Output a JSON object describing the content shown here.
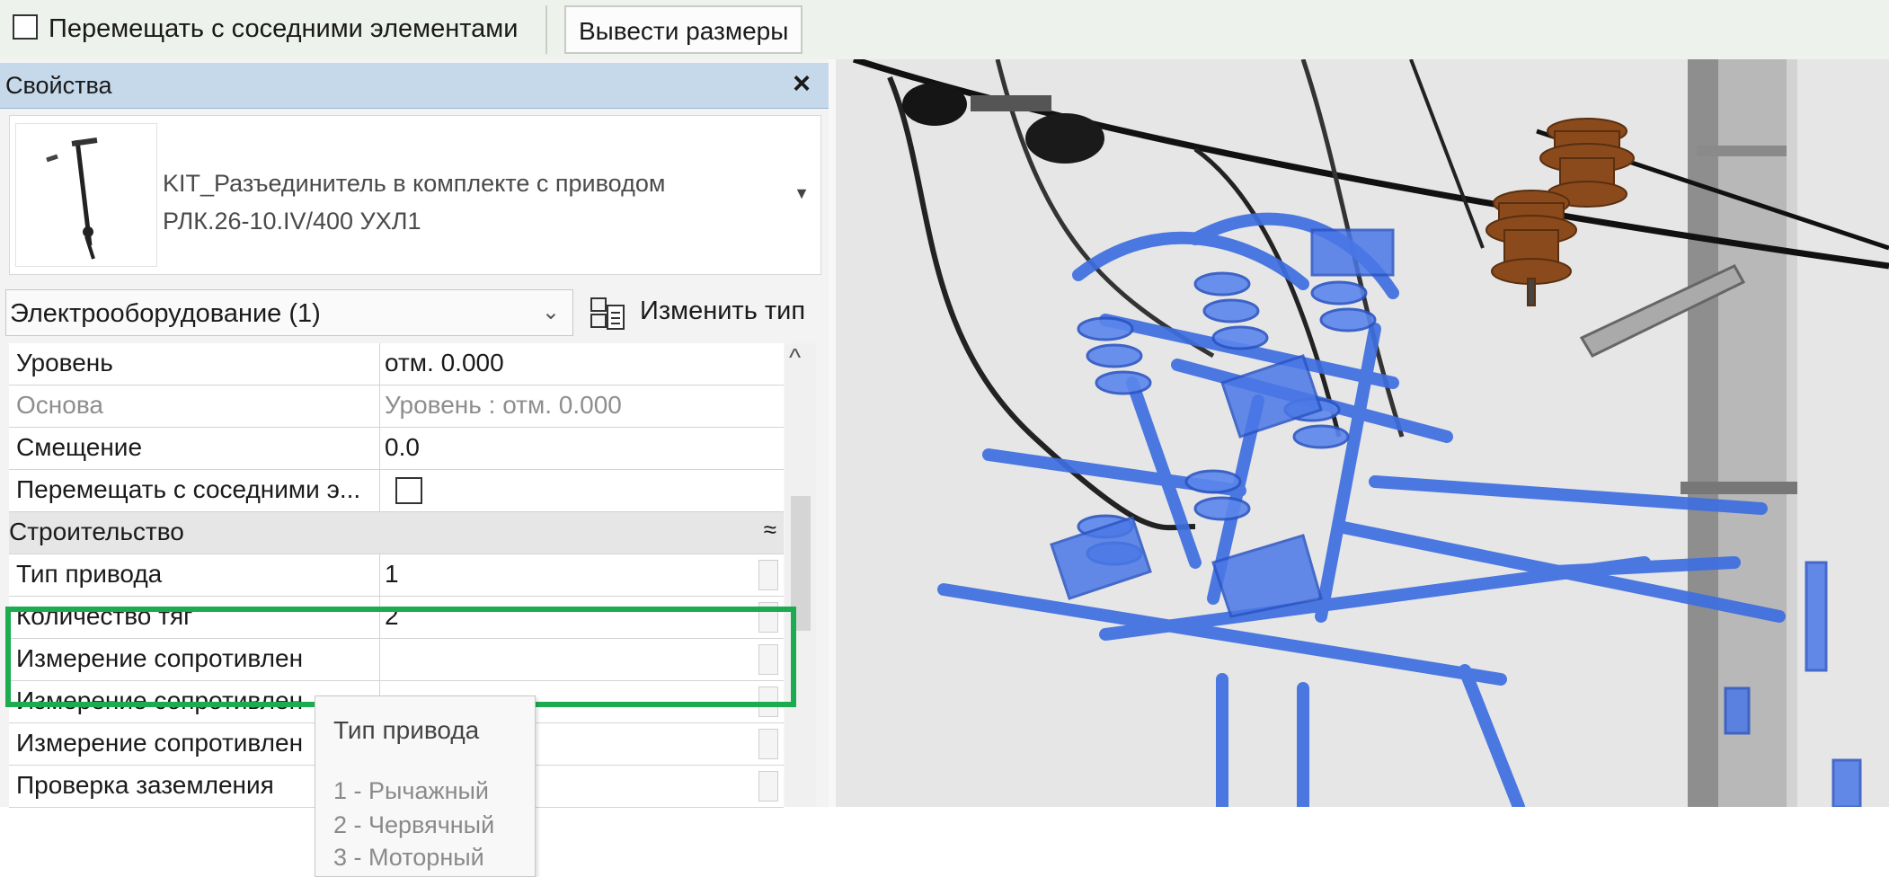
{
  "toolbar": {
    "move_with_neighbors_label": "Перемещать с соседними элементами",
    "show_dimensions_label": "Вывести размеры"
  },
  "properties": {
    "title": "Свойства",
    "close_glyph": "×",
    "type_name_line1": "KIT_Разъединитель в комплекте с приводом",
    "type_name_line2": "РЛК.26-10.IV/400 УХЛ1",
    "category": "Электрооборудование (1)",
    "edit_type_label": "Изменить тип",
    "rows": [
      {
        "name": "Уровень",
        "value": "отм. 0.000"
      },
      {
        "name": "Основа",
        "value": "Уровень : отм. 0.000"
      },
      {
        "name": "Смещение",
        "value": "0.0"
      },
      {
        "name": "Перемещать с соседними э...",
        "value": ""
      }
    ],
    "group_name": "Строительство",
    "group_toggle": "≈",
    "group_rows": [
      {
        "name": "Тип привода",
        "value": "1"
      },
      {
        "name": "Количество тяг",
        "value": "2"
      },
      {
        "name": "Измерение сопротивлен",
        "value": ""
      },
      {
        "name": "Измерение сопротивлен",
        "value": ""
      },
      {
        "name": "Измерение сопротивлен",
        "value": ""
      },
      {
        "name": "Проверка заземления",
        "value": ""
      }
    ]
  },
  "tooltip": {
    "title": "Тип привода",
    "options": [
      "1 - Рычажный",
      "2 - Червячный",
      "3 - Моторный"
    ]
  },
  "colors": {
    "highlight": "#1cab4e",
    "equipment_blue": "#3e6ee0",
    "insulator_brown": "#8a4a1c"
  }
}
